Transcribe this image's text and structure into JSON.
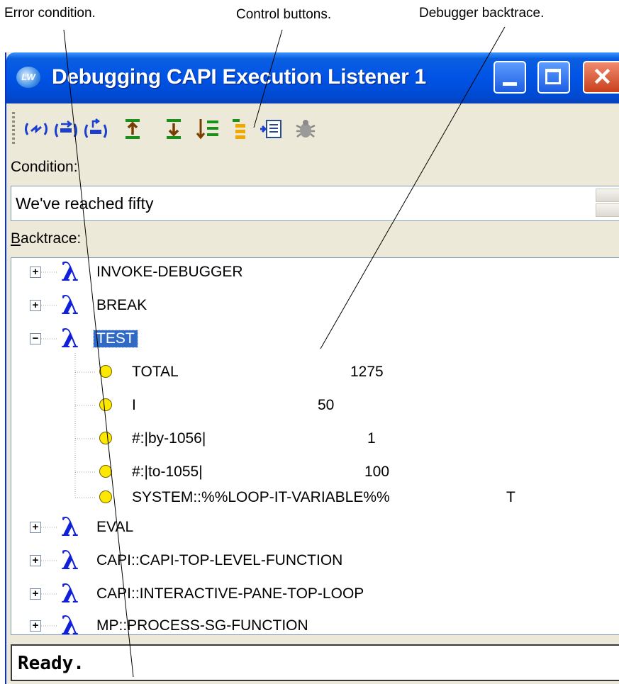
{
  "callouts": {
    "error_condition": "Error condition.",
    "control_buttons": "Control buttons.",
    "debugger_backtrace": "Debugger backtrace."
  },
  "window": {
    "title": "Debugging CAPI Execution Listener 1",
    "logo_text": "LW",
    "minimize": "minimize",
    "maximize": "maximize",
    "close": "close"
  },
  "toolbar": {
    "buttons": [
      "abort-icon",
      "continue-icon",
      "restart-icon",
      "frame-up-icon",
      "frame-down-icon",
      "bottom-frame-icon",
      "top-frame-icon",
      "find-source-icon",
      "bug-report-icon"
    ]
  },
  "condition": {
    "label": "Condition:",
    "value": "We've reached fifty"
  },
  "backtrace": {
    "label_accel": "B",
    "label_rest": "acktrace:",
    "frames_before": [
      {
        "label": "INVOKE-DEBUGGER",
        "expander": "+"
      },
      {
        "label": "BREAK",
        "expander": "+"
      }
    ],
    "selected_frame": {
      "label": "TEST",
      "expander": "−"
    },
    "variables": [
      {
        "name": "TOTAL",
        "value": "1275"
      },
      {
        "name": "I",
        "value": "50"
      },
      {
        "name": "#:|by-1056|",
        "value": "1"
      },
      {
        "name": "#:|to-1055|",
        "value": "100"
      },
      {
        "name": "SYSTEM::%%LOOP-IT-VARIABLE%%",
        "value": "T"
      }
    ],
    "frames_after": [
      {
        "label": "EVAL",
        "expander": "+"
      },
      {
        "label": "CAPI::CAPI-TOP-LEVEL-FUNCTION",
        "expander": "+"
      },
      {
        "label": "CAPI::INTERACTIVE-PANE-TOP-LOOP",
        "expander": "+"
      },
      {
        "label": "MP::PROCESS-SG-FUNCTION",
        "expander": "+"
      }
    ]
  },
  "status": {
    "text": "Ready."
  }
}
